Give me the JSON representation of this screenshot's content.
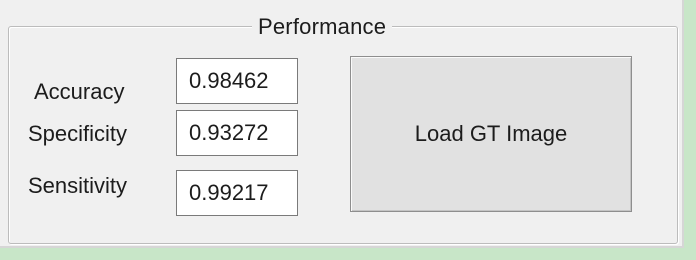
{
  "group": {
    "title": "Performance"
  },
  "metrics": {
    "accuracy": {
      "label": "Accuracy",
      "value": "0.98462"
    },
    "specificity": {
      "label": "Specificity",
      "value": "0.93272"
    },
    "sensitivity": {
      "label": "Sensitivity",
      "value": "0.99217"
    }
  },
  "actions": {
    "load_gt_label": "Load GT Image"
  },
  "colors": {
    "window_background": "#c8e6c8",
    "panel_background": "#f0f0f0",
    "button_face": "#e1e1e1"
  }
}
